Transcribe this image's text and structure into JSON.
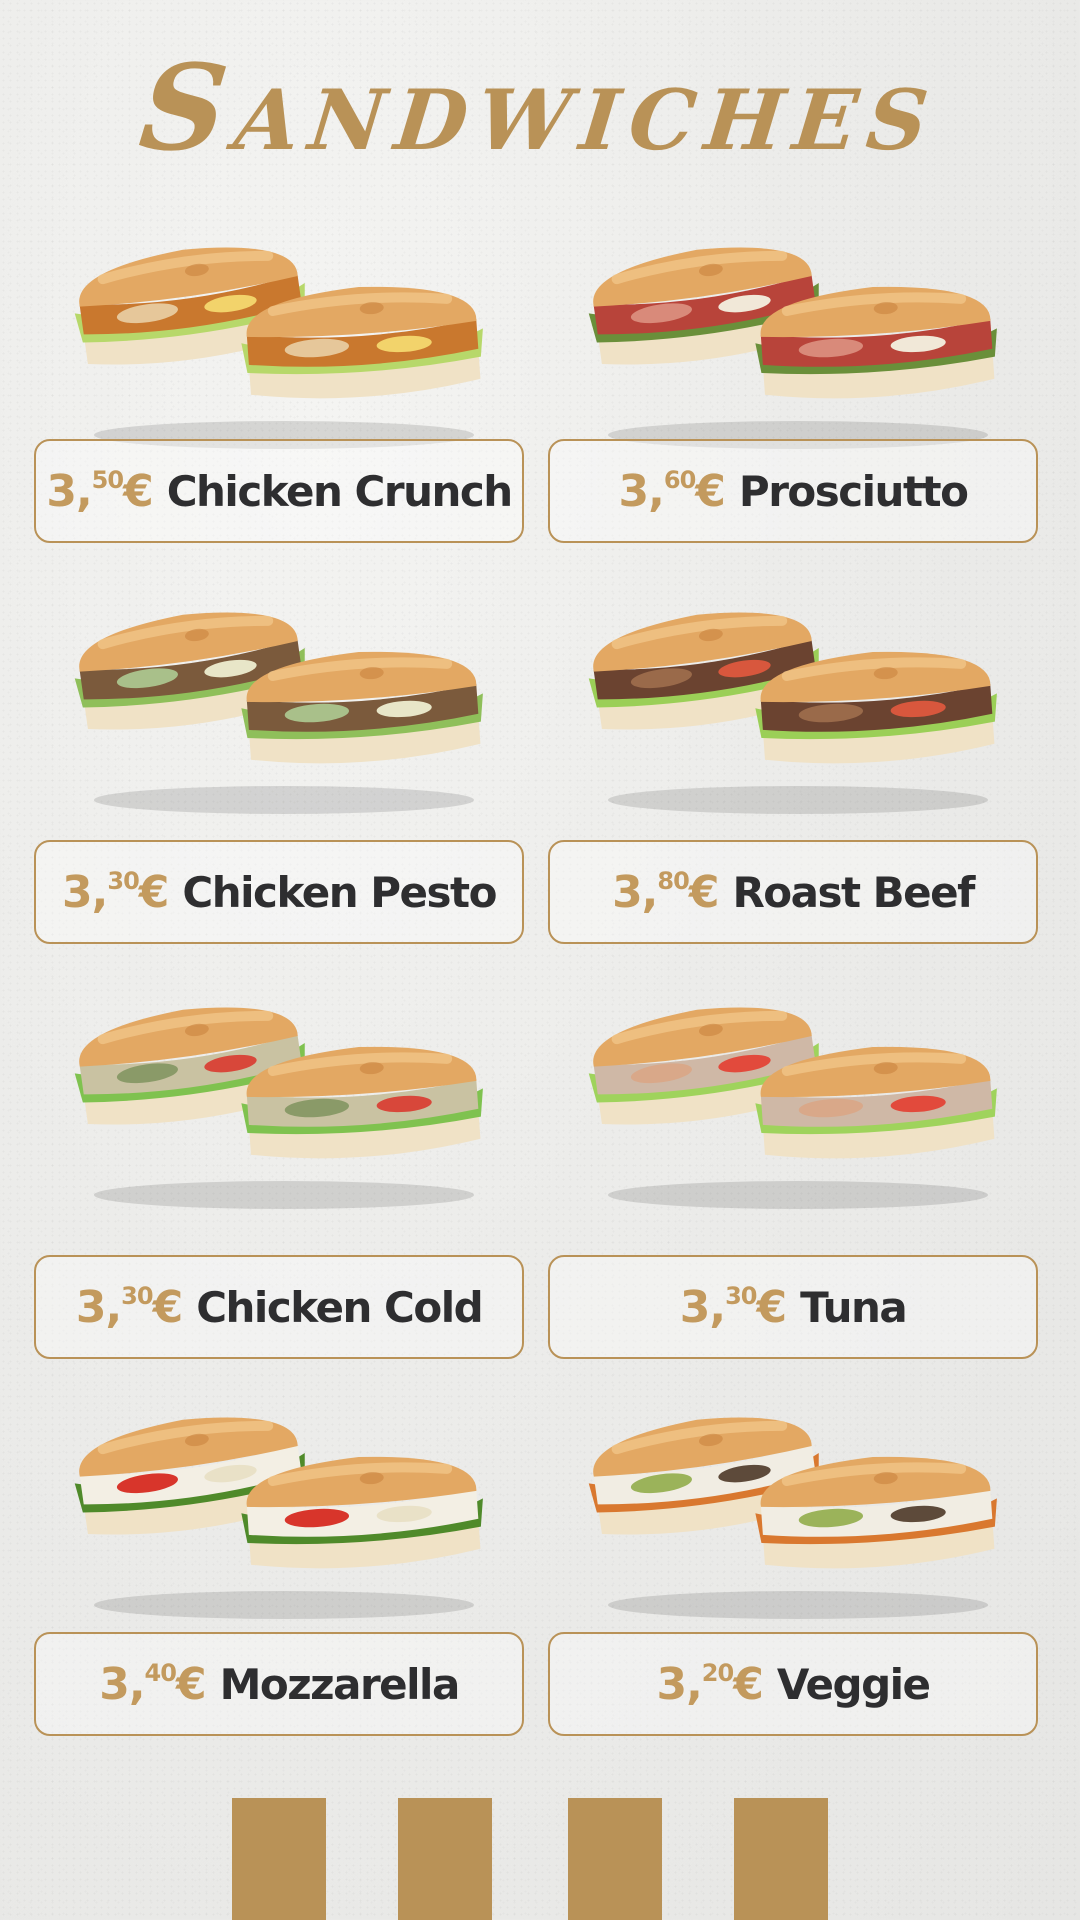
{
  "menu": {
    "title": "Sandwiches",
    "accent_color": "#b99257",
    "text_color": "#2e2e30",
    "items": [
      {
        "whole": "3,",
        "cents": "50",
        "currency": "€",
        "name": "Chicken Crunch",
        "filling": "crispy-chicken"
      },
      {
        "whole": "3,",
        "cents": "60",
        "currency": "€",
        "name": "Prosciutto",
        "filling": "prosciutto"
      },
      {
        "whole": "3,",
        "cents": "30",
        "currency": "€",
        "name": "Chicken Pesto",
        "filling": "grilled-chicken-pesto"
      },
      {
        "whole": "3,",
        "cents": "80",
        "currency": "€",
        "name": "Roast Beef",
        "filling": "roast-beef"
      },
      {
        "whole": "3,",
        "cents": "30",
        "currency": "€",
        "name": "Chicken Cold",
        "filling": "chicken-salad"
      },
      {
        "whole": "3,",
        "cents": "30",
        "currency": "€",
        "name": "Tuna",
        "filling": "tuna-salad"
      },
      {
        "whole": "3,",
        "cents": "40",
        "currency": "€",
        "name": "Mozzarella",
        "filling": "mozzarella-tomato"
      },
      {
        "whole": "3,",
        "cents": "20",
        "currency": "€",
        "name": "Veggie",
        "filling": "grilled-vegetables"
      }
    ]
  }
}
